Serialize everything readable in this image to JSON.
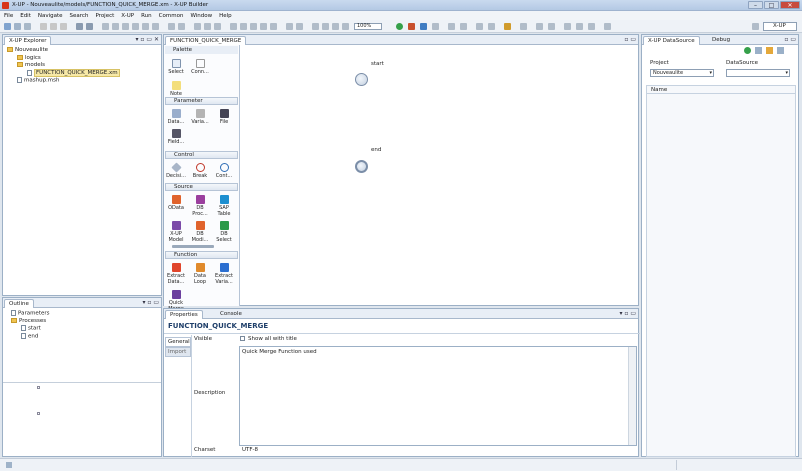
{
  "window": {
    "title": "X-UP - Nouveaulite/models/FUNCTION_QUICK_MERGE.xm - X-UP Builder",
    "minimize": "–",
    "maximize": "□",
    "close": "✕"
  },
  "menu": [
    "File",
    "Edit",
    "Navigate",
    "Search",
    "Project",
    "X-UP",
    "Run",
    "Common",
    "Window",
    "Help"
  ],
  "toolbar": {
    "zoom": "100%",
    "perspective": "X-UP"
  },
  "explorer": {
    "tab": "X-UP Explorer",
    "tree": [
      "Nouveaulite",
      "logics",
      "models",
      "FUNCTION_QUICK_MERGE.xm",
      "mashup.msh"
    ]
  },
  "outline": {
    "tab": "Outline",
    "tree": [
      "Parameters",
      "Processes",
      "start",
      "end"
    ]
  },
  "editor": {
    "tab": "FUNCTION_QUICK_MERGE",
    "nodes": {
      "start": "start",
      "end": "end"
    }
  },
  "palette": {
    "title": "Palette",
    "tools": [
      "Select",
      "Conn..."
    ],
    "note": "Note",
    "groups": {
      "parameter": {
        "title": "Parameter",
        "items": [
          "Data...",
          "Varia...",
          "File",
          "Field..."
        ]
      },
      "control": {
        "title": "Control",
        "items": [
          "Decisi...",
          "Break",
          "Cont..."
        ]
      },
      "source": {
        "title": "Source",
        "items": [
          "OData",
          "DB Proc...",
          "SAP Table",
          "X-UP Model",
          "DB Modi...",
          "DB Select"
        ]
      },
      "function": {
        "title": "Function",
        "items": [
          "Extract Data...",
          "Data Loop",
          "Extract Varia...",
          "Quick Merge"
        ]
      }
    }
  },
  "properties": {
    "tab": "Properties",
    "console_tab": "Console",
    "title": "FUNCTION_QUICK_MERGE",
    "side_tabs": [
      "General",
      "Import"
    ],
    "visible_label": "Visible",
    "visible_check": "Show all with title",
    "description_label": "Description",
    "description_value": "Quick Merge Function used",
    "charset_label": "Charset",
    "charset_value": "UTF-8"
  },
  "datasource": {
    "tab": "X-UP DataSource",
    "debug_tab": "Debug",
    "project_label": "Project",
    "project_value": "Nouveaulite",
    "ds_label": "DataSource",
    "ds_value": "",
    "list_header": "Name"
  },
  "colors": {
    "accent": "#d8361b",
    "panel_border": "#9cb0c6",
    "tab_bg": "#e8eef6"
  }
}
